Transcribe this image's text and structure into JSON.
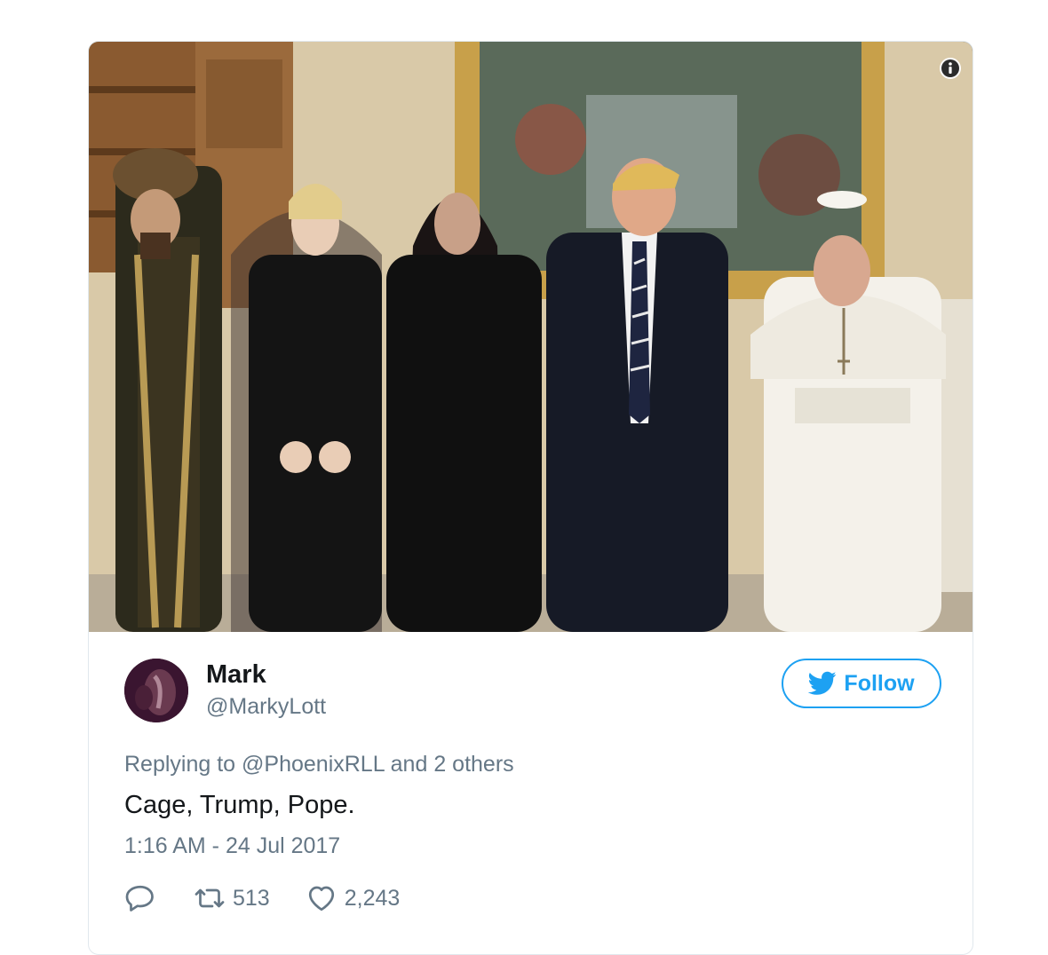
{
  "tweet": {
    "author": {
      "name": "Mark",
      "handle": "@MarkyLott"
    },
    "follow_label": "Follow",
    "replying_prefix": "Replying to",
    "replying_to": "@PhoenixRLL",
    "replying_suffix": "and 2 others",
    "text": "Cage, Trump, Pope.",
    "timestamp": "1:16 AM - 24 Jul 2017",
    "retweets": "513",
    "likes": "2,243"
  },
  "icons": {
    "info": "info-icon",
    "follow": "twitter-bird-icon",
    "reply": "reply-icon",
    "retweet": "retweet-icon",
    "like": "heart-icon"
  },
  "colors": {
    "accent": "#1da1f2",
    "secondary_text": "#657786",
    "primary_text": "#14171a",
    "border": "#e1e8ed"
  }
}
